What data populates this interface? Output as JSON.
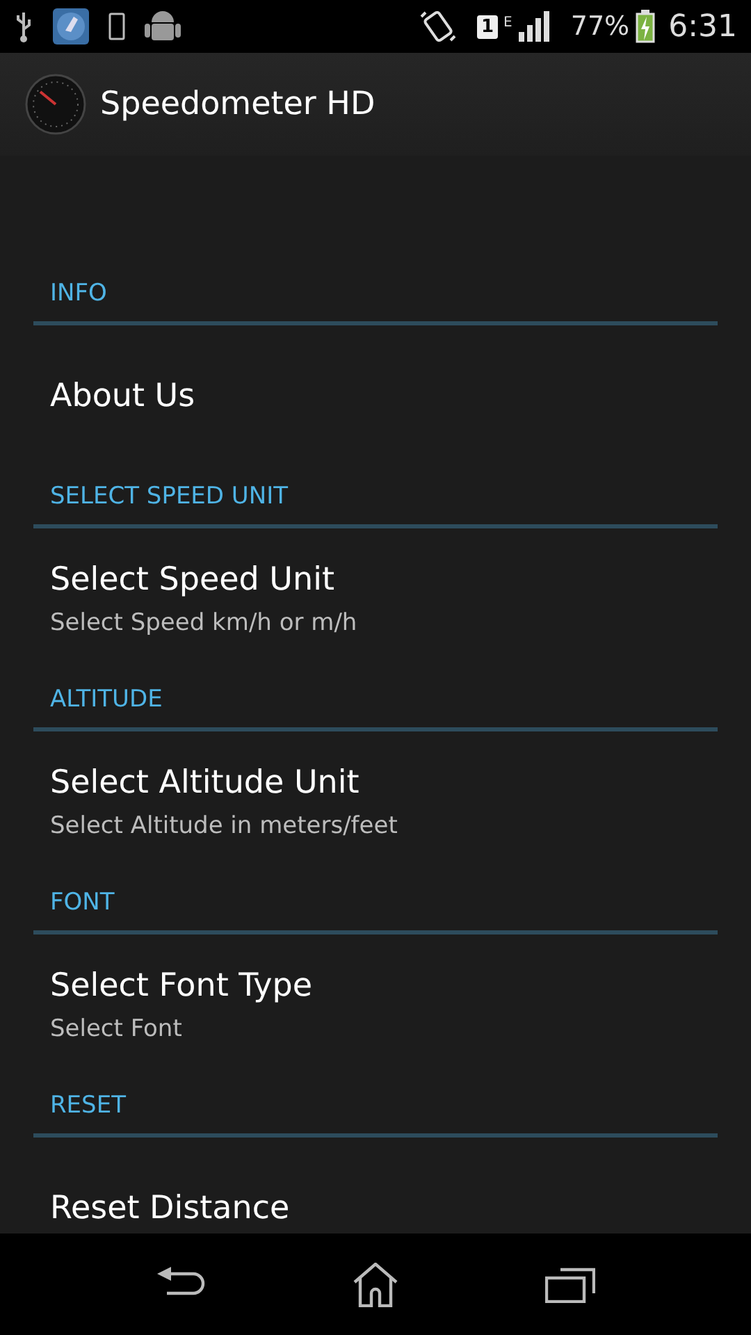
{
  "status_bar": {
    "sim_slot": "1",
    "network_type": "E",
    "battery": "77%",
    "time": "6:31"
  },
  "action_bar": {
    "title": "Speedometer HD"
  },
  "sections": [
    {
      "header": "INFO",
      "items": [
        {
          "title": "About Us"
        }
      ]
    },
    {
      "header": "SELECT SPEED UNIT",
      "items": [
        {
          "title": "Select Speed Unit",
          "summary": "Select Speed km/h or m/h"
        }
      ]
    },
    {
      "header": "ALTITUDE",
      "items": [
        {
          "title": "Select Altitude Unit",
          "summary": "Select Altitude in meters/feet"
        }
      ]
    },
    {
      "header": "FONT",
      "items": [
        {
          "title": "Select Font Type",
          "summary": "Select Font"
        }
      ]
    },
    {
      "header": "RESET",
      "items": [
        {
          "title": "Reset Distance"
        }
      ]
    }
  ]
}
